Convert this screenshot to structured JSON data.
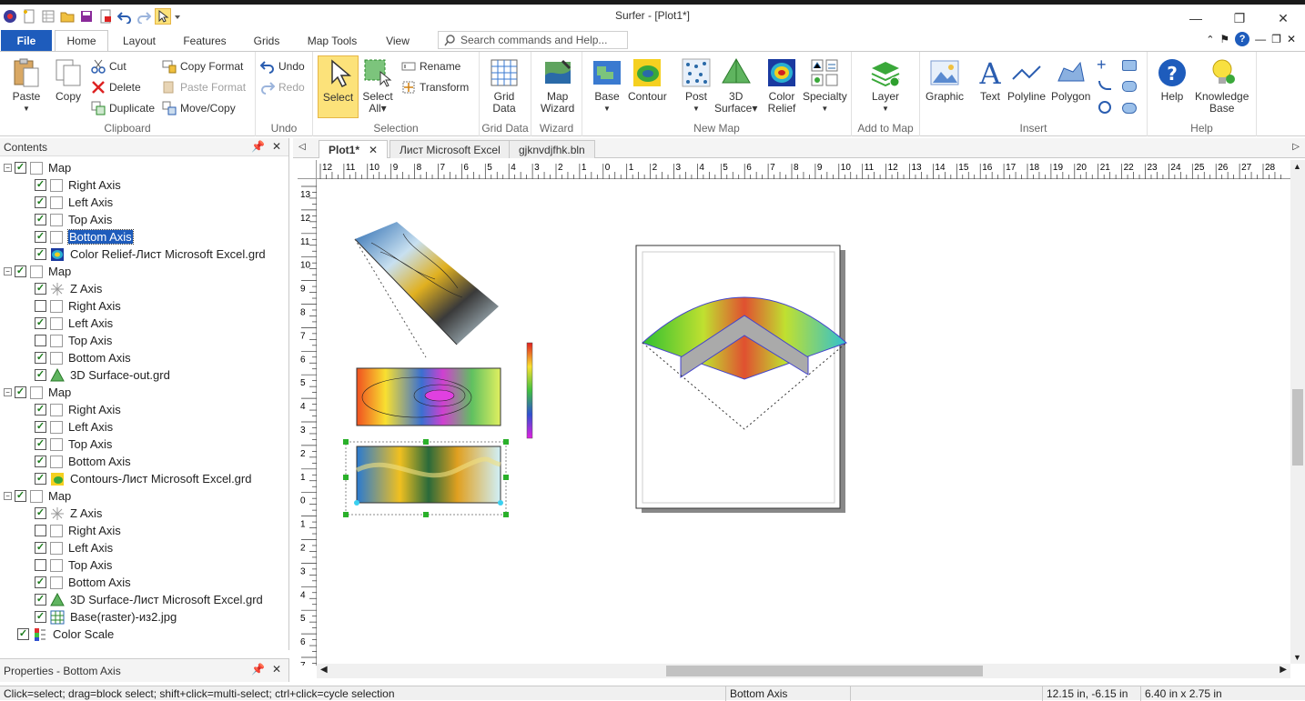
{
  "app_title": "Surfer - [Plot1*]",
  "ribbon_tabs": {
    "file": "File",
    "home": "Home",
    "layout": "Layout",
    "features": "Features",
    "grids": "Grids",
    "map_tools": "Map Tools",
    "view": "View"
  },
  "search_placeholder": "Search commands and Help...",
  "clipboard": {
    "paste": "Paste",
    "copy": "Copy",
    "cut": "Cut",
    "delete": "Delete",
    "duplicate": "Duplicate",
    "copy_format": "Copy Format",
    "paste_format": "Paste Format",
    "move_copy": "Move/Copy",
    "group": "Clipboard"
  },
  "undo": {
    "undo": "Undo",
    "redo": "Redo",
    "group": "Undo"
  },
  "selection": {
    "select": "Select",
    "select_all_1": "Select",
    "select_all_2": "All",
    "rename": "Rename",
    "transform": "Transform",
    "group": "Selection"
  },
  "grid_data": {
    "label1": "Grid",
    "label2": "Data",
    "group": "Grid Data"
  },
  "wizard": {
    "label1": "Map",
    "label2": "Wizard",
    "group": "Wizard"
  },
  "new_map": {
    "base": "Base",
    "contour": "Contour",
    "post": "Post",
    "surface1": "3D",
    "surface2": "Surface",
    "relief1": "Color",
    "relief2": "Relief",
    "specialty": "Specialty",
    "group": "New Map"
  },
  "add_to_map": {
    "layer": "Layer",
    "group": "Add to Map"
  },
  "insert": {
    "graphic": "Graphic",
    "text": "Text",
    "polyline": "Polyline",
    "polygon": "Polygon",
    "group": "Insert"
  },
  "help": {
    "help": "Help",
    "kb1": "Knowledge",
    "kb2": "Base",
    "group": "Help"
  },
  "contents": {
    "title": "Contents",
    "items": [
      {
        "label": "Map",
        "level": 0,
        "checked": true,
        "icon": "map"
      },
      {
        "label": "Right Axis",
        "level": 1,
        "checked": true,
        "icon": "axis"
      },
      {
        "label": "Left Axis",
        "level": 1,
        "checked": true,
        "icon": "axis"
      },
      {
        "label": "Top Axis",
        "level": 1,
        "checked": true,
        "icon": "axis"
      },
      {
        "label": "Bottom Axis",
        "level": 1,
        "checked": true,
        "icon": "axis",
        "selected": true
      },
      {
        "label": "Color Relief-Лист Microsoft Excel.grd",
        "level": 1,
        "checked": true,
        "icon": "relief"
      },
      {
        "label": "Map",
        "level": 0,
        "checked": true,
        "icon": "map"
      },
      {
        "label": "Z Axis",
        "level": 1,
        "checked": true,
        "icon": "zaxis"
      },
      {
        "label": "Right Axis",
        "level": 1,
        "checked": false,
        "icon": "axis"
      },
      {
        "label": "Left Axis",
        "level": 1,
        "checked": true,
        "icon": "axis"
      },
      {
        "label": "Top Axis",
        "level": 1,
        "checked": false,
        "icon": "axis"
      },
      {
        "label": "Bottom Axis",
        "level": 1,
        "checked": true,
        "icon": "axis"
      },
      {
        "label": "3D Surface-out.grd",
        "level": 1,
        "checked": true,
        "icon": "surface"
      },
      {
        "label": "Map",
        "level": 0,
        "checked": true,
        "icon": "map"
      },
      {
        "label": "Right Axis",
        "level": 1,
        "checked": true,
        "icon": "axis"
      },
      {
        "label": "Left Axis",
        "level": 1,
        "checked": true,
        "icon": "axis"
      },
      {
        "label": "Top Axis",
        "level": 1,
        "checked": true,
        "icon": "axis"
      },
      {
        "label": "Bottom Axis",
        "level": 1,
        "checked": true,
        "icon": "axis"
      },
      {
        "label": "Contours-Лист Microsoft Excel.grd",
        "level": 1,
        "checked": true,
        "icon": "contour"
      },
      {
        "label": "Map",
        "level": 0,
        "checked": true,
        "icon": "map"
      },
      {
        "label": "Z Axis",
        "level": 1,
        "checked": true,
        "icon": "zaxis"
      },
      {
        "label": "Right Axis",
        "level": 1,
        "checked": false,
        "icon": "axis"
      },
      {
        "label": "Left Axis",
        "level": 1,
        "checked": true,
        "icon": "axis"
      },
      {
        "label": "Top Axis",
        "level": 1,
        "checked": false,
        "icon": "axis"
      },
      {
        "label": "Bottom Axis",
        "level": 1,
        "checked": true,
        "icon": "axis"
      },
      {
        "label": "3D Surface-Лист Microsoft Excel.grd",
        "level": 1,
        "checked": true,
        "icon": "surface"
      },
      {
        "label": "Base(raster)-из2.jpg",
        "level": 1,
        "checked": true,
        "icon": "raster"
      },
      {
        "label": "Color Scale",
        "level": 0,
        "checked": true,
        "icon": "scale",
        "no_expander": true
      }
    ]
  },
  "properties_title": "Properties - Bottom Axis",
  "doc_tabs": [
    "Plot1*",
    "Лист Microsoft Excel",
    "gjknvdjfhk.bln"
  ],
  "ruler": {
    "h_labels": [
      "12",
      "11",
      "10",
      "9",
      "8",
      "7",
      "6",
      "5",
      "4",
      "3",
      "2",
      "1",
      "0",
      "1",
      "2",
      "3",
      "4",
      "5",
      "6",
      "7",
      "8",
      "9",
      "10",
      "11",
      "12",
      "13",
      "14",
      "15",
      "16",
      "17",
      "18",
      "19",
      "20",
      "21",
      "22",
      "23",
      "24",
      "25",
      "26",
      "27",
      "28"
    ],
    "v_labels": [
      "13",
      "12",
      "11",
      "10",
      "9",
      "8",
      "7",
      "6",
      "5",
      "4",
      "3",
      "2",
      "1",
      "0",
      "1",
      "2",
      "3",
      "4",
      "5",
      "6",
      "7"
    ]
  },
  "status": {
    "hint": "Click=select; drag=block select; shift+click=multi-select; ctrl+click=cycle selection",
    "selection": "Bottom Axis",
    "position": "12.15 in, -6.15 in",
    "size": "6.40 in x 2.75 in"
  },
  "colors": {
    "accent": "#1e5cbc",
    "select_highlight": "#fce27a"
  }
}
